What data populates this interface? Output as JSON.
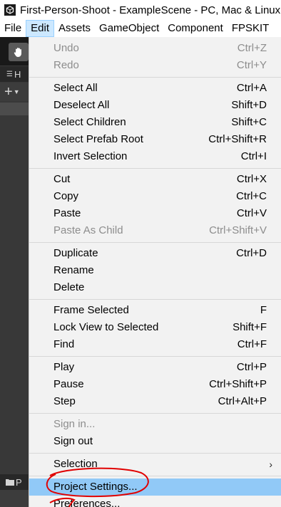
{
  "window": {
    "title": "First-Person-Shoot - ExampleScene - PC, Mac & Linux"
  },
  "menubar": {
    "items": [
      "File",
      "Edit",
      "Assets",
      "GameObject",
      "Component",
      "FPSKIT"
    ]
  },
  "editor": {
    "hierarchy_tab": "H",
    "project_tab": "P"
  },
  "edit_menu": {
    "groups": [
      [
        {
          "label": "Undo",
          "shortcut": "Ctrl+Z",
          "disabled": true
        },
        {
          "label": "Redo",
          "shortcut": "Ctrl+Y",
          "disabled": true
        }
      ],
      [
        {
          "label": "Select All",
          "shortcut": "Ctrl+A"
        },
        {
          "label": "Deselect All",
          "shortcut": "Shift+D"
        },
        {
          "label": "Select Children",
          "shortcut": "Shift+C"
        },
        {
          "label": "Select Prefab Root",
          "shortcut": "Ctrl+Shift+R"
        },
        {
          "label": "Invert Selection",
          "shortcut": "Ctrl+I"
        }
      ],
      [
        {
          "label": "Cut",
          "shortcut": "Ctrl+X"
        },
        {
          "label": "Copy",
          "shortcut": "Ctrl+C"
        },
        {
          "label": "Paste",
          "shortcut": "Ctrl+V"
        },
        {
          "label": "Paste As Child",
          "shortcut": "Ctrl+Shift+V",
          "disabled": true
        }
      ],
      [
        {
          "label": "Duplicate",
          "shortcut": "Ctrl+D"
        },
        {
          "label": "Rename",
          "shortcut": ""
        },
        {
          "label": "Delete",
          "shortcut": ""
        }
      ],
      [
        {
          "label": "Frame Selected",
          "shortcut": "F"
        },
        {
          "label": "Lock View to Selected",
          "shortcut": "Shift+F"
        },
        {
          "label": "Find",
          "shortcut": "Ctrl+F"
        }
      ],
      [
        {
          "label": "Play",
          "shortcut": "Ctrl+P"
        },
        {
          "label": "Pause",
          "shortcut": "Ctrl+Shift+P"
        },
        {
          "label": "Step",
          "shortcut": "Ctrl+Alt+P"
        }
      ],
      [
        {
          "label": "Sign in...",
          "shortcut": "",
          "disabled": true
        },
        {
          "label": "Sign out",
          "shortcut": ""
        }
      ],
      [
        {
          "label": "Selection",
          "shortcut": "",
          "submenu": true
        }
      ],
      [
        {
          "label": "Project Settings...",
          "shortcut": "",
          "highlighted": true
        },
        {
          "label": "Preferences...",
          "shortcut": ""
        }
      ]
    ]
  },
  "colors": {
    "menu_bg": "#f2f2f2",
    "highlight": "#91c9f7",
    "active_menu": "#cce8ff",
    "annotation": "#e00000"
  }
}
